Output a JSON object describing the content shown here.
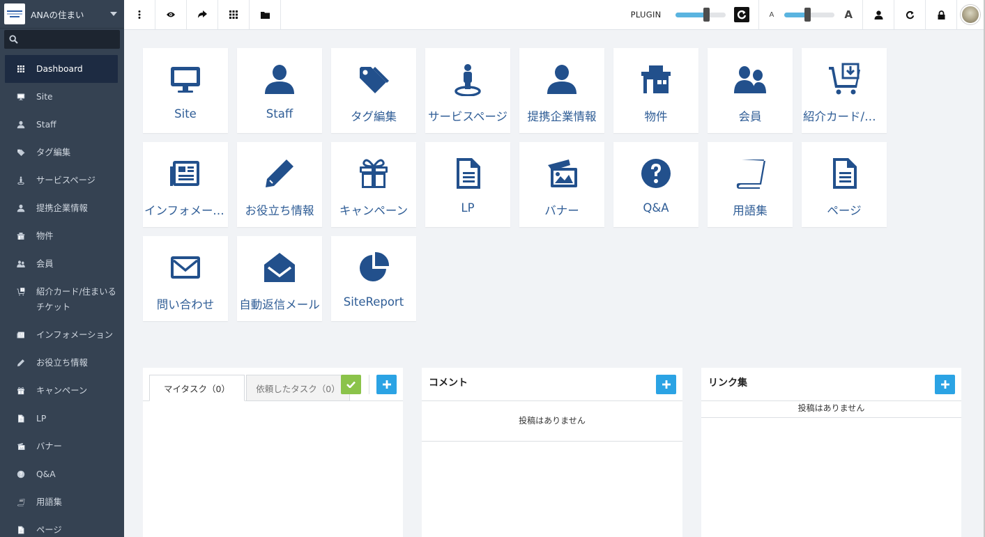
{
  "app": {
    "site_name": "ANAの住まい",
    "search_placeholder": ""
  },
  "sidebar": {
    "items": [
      {
        "label": "Dashboard",
        "icon": "grid-icon"
      },
      {
        "label": "Site",
        "icon": "monitor-icon"
      },
      {
        "label": "Staff",
        "icon": "user-icon"
      },
      {
        "label": "タグ編集",
        "icon": "tags-icon"
      },
      {
        "label": "サービスページ",
        "icon": "street-view-icon"
      },
      {
        "label": "提携企業情報",
        "icon": "user-icon"
      },
      {
        "label": "物件",
        "icon": "house-icon"
      },
      {
        "label": "会員",
        "icon": "users-icon"
      },
      {
        "label": "紹介カード/住まいるチケット",
        "icon": "cart-icon"
      },
      {
        "label": "インフォメーション",
        "icon": "newspaper-icon"
      },
      {
        "label": "お役立ち情報",
        "icon": "pencil-icon"
      },
      {
        "label": "キャンペーン",
        "icon": "gift-icon"
      },
      {
        "label": "LP",
        "icon": "file-icon"
      },
      {
        "label": "バナー",
        "icon": "images-icon"
      },
      {
        "label": "Q&A",
        "icon": "question-icon"
      },
      {
        "label": "用語集",
        "icon": "book-icon"
      },
      {
        "label": "ページ",
        "icon": "file-icon"
      }
    ]
  },
  "topbar": {
    "plugin_label": "PLUGIN",
    "plugin_level": 0.62,
    "font_small_label": "A",
    "font_large_label": "A",
    "font_level": 0.45
  },
  "tiles": [
    {
      "label": "Site",
      "icon": "monitor-icon"
    },
    {
      "label": "Staff",
      "icon": "user-icon"
    },
    {
      "label": "タグ編集",
      "icon": "tags-icon"
    },
    {
      "label": "サービスページ",
      "icon": "street-view-icon"
    },
    {
      "label": "提携企業情報",
      "icon": "user-icon"
    },
    {
      "label": "物件",
      "icon": "house-icon"
    },
    {
      "label": "会員",
      "icon": "users-icon"
    },
    {
      "label": "紹介カード/住まいるチケット",
      "icon": "cart-icon"
    },
    {
      "label": "インフォメーション",
      "icon": "newspaper-icon"
    },
    {
      "label": "お役立ち情報",
      "icon": "pencil-icon"
    },
    {
      "label": "キャンペーン",
      "icon": "gift-icon"
    },
    {
      "label": "LP",
      "icon": "file-icon"
    },
    {
      "label": "バナー",
      "icon": "images-icon"
    },
    {
      "label": "Q&A",
      "icon": "question-icon"
    },
    {
      "label": "用語集",
      "icon": "book-icon"
    },
    {
      "label": "ページ",
      "icon": "file-icon"
    },
    {
      "label": "問い合わせ",
      "icon": "envelope-icon"
    },
    {
      "label": "自動返信メール",
      "icon": "envelope-open-icon"
    },
    {
      "label": "SiteReport",
      "icon": "pie-chart-icon"
    }
  ],
  "panels": {
    "tasks": {
      "tab_mine": "マイタスク（0）",
      "tab_requested": "依頼したタスク（0）"
    },
    "comments": {
      "title": "コメント",
      "empty": "投稿はありません"
    },
    "links": {
      "title": "リンク集",
      "empty": "投稿はありません"
    }
  },
  "colors": {
    "sidebar_bg": "#354252",
    "active_bg": "#1d2b42",
    "tile_icon": "#22508c",
    "plus_button": "#2ba3e4",
    "check_button": "#8bc34a"
  }
}
